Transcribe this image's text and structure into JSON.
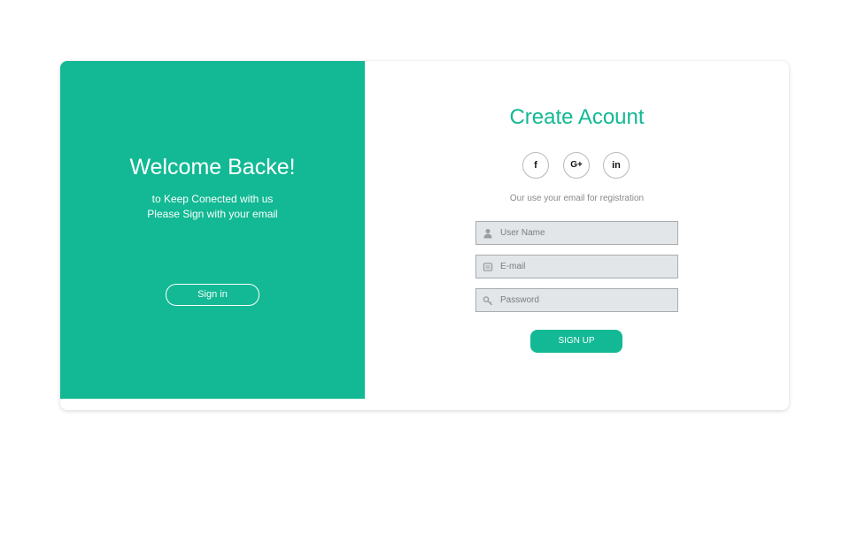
{
  "colors": {
    "accent": "#12b994",
    "field_background": "#e2e6e9",
    "muted_text": "#888888"
  },
  "welcome_panel": {
    "title": "Welcome Backe!",
    "line1": "to Keep Conected with us",
    "line2": "Please Sign with your email",
    "signin_label": "Sign in"
  },
  "register_panel": {
    "title": "Create Acount",
    "social": [
      {
        "icon": "facebook-icon",
        "glyph": "f"
      },
      {
        "icon": "google-plus-icon",
        "glyph": "G+"
      },
      {
        "icon": "linkedin-icon",
        "glyph": "in"
      }
    ],
    "subtext": "Our use your email for registration",
    "fields": {
      "username": {
        "placeholder": "User Name",
        "icon": "user-icon"
      },
      "email": {
        "placeholder": "E-mail",
        "icon": "email-icon"
      },
      "password": {
        "placeholder": "Password",
        "icon": "key-icon"
      }
    },
    "signup_label": "SIGN UP"
  }
}
